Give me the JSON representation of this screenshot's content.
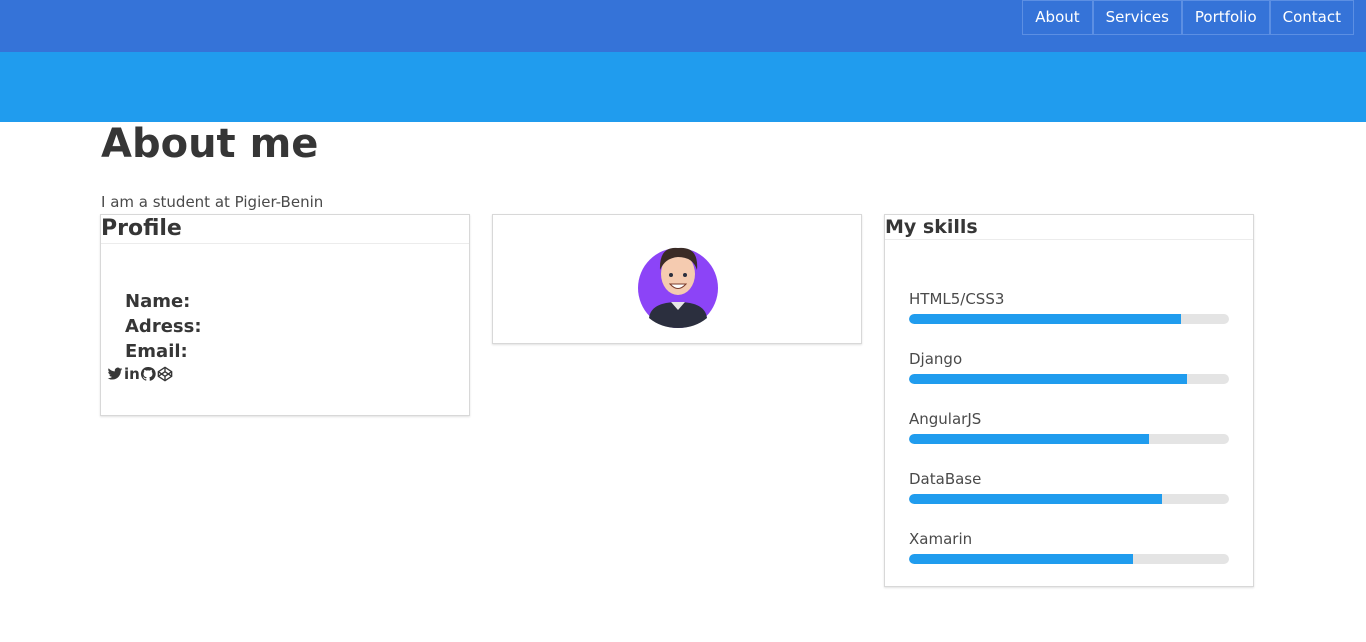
{
  "nav": {
    "links": [
      "About",
      "Services",
      "Portfolio",
      "Contact"
    ]
  },
  "colors": {
    "navbar": "#3573d8",
    "banner": "#209cee",
    "bar": "#209cee",
    "track": "#e4e4e4"
  },
  "about": {
    "title": "About me",
    "intro": "I am a student at Pigier-Benin"
  },
  "profile": {
    "title": "Profile",
    "fields": [
      "Name:",
      "Adress:",
      "Email:"
    ],
    "social_icons": [
      "twitter-icon",
      "linkedin-icon",
      "github-icon",
      "codepen-icon"
    ]
  },
  "skills": {
    "title": "My skills",
    "items": [
      {
        "name": "HTML5/CSS3",
        "percent": 85
      },
      {
        "name": "Django",
        "percent": 87
      },
      {
        "name": "AngularJS",
        "percent": 75
      },
      {
        "name": "DataBase",
        "percent": 79
      },
      {
        "name": "Xamarin",
        "percent": 70
      }
    ]
  }
}
